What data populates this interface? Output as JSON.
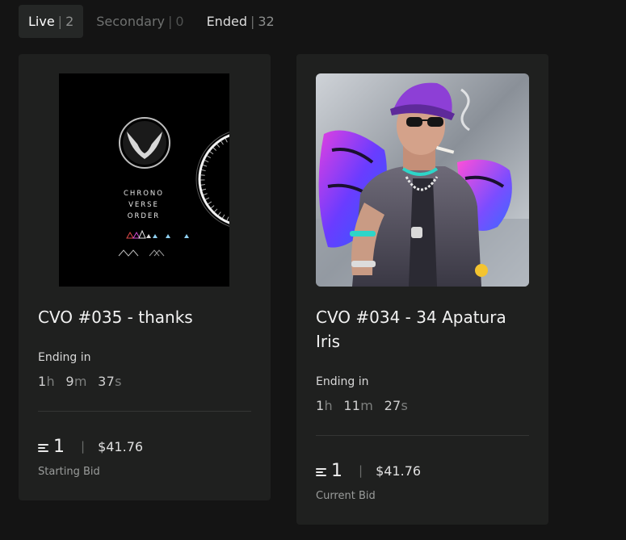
{
  "tabs": [
    {
      "label": "Live",
      "count": "2"
    },
    {
      "label": "Secondary",
      "count": "0"
    },
    {
      "label": "Ended",
      "count": "32"
    }
  ],
  "separator": "|",
  "cards": [
    {
      "art_text": [
        "CHRONO",
        "VERSE",
        "ORDER"
      ],
      "title": "CVO #035 - thanks",
      "ending_label": "Ending in",
      "timer": {
        "h": "1",
        "m": "9",
        "s": "37",
        "h_unit": "h",
        "m_unit": "m",
        "s_unit": "s"
      },
      "bid": "1",
      "usd": "$41.76",
      "bid_label": "Starting Bid"
    },
    {
      "title": "CVO #034 - 34 Apatura Iris",
      "ending_label": "Ending in",
      "timer": {
        "h": "1",
        "m": "11",
        "s": "27",
        "h_unit": "h",
        "m_unit": "m",
        "s_unit": "s"
      },
      "bid": "1",
      "usd": "$41.76",
      "bid_label": "Current Bid"
    }
  ],
  "colors": {
    "background": "#141414",
    "card": "#1f201f",
    "active_tab": "#252726"
  }
}
